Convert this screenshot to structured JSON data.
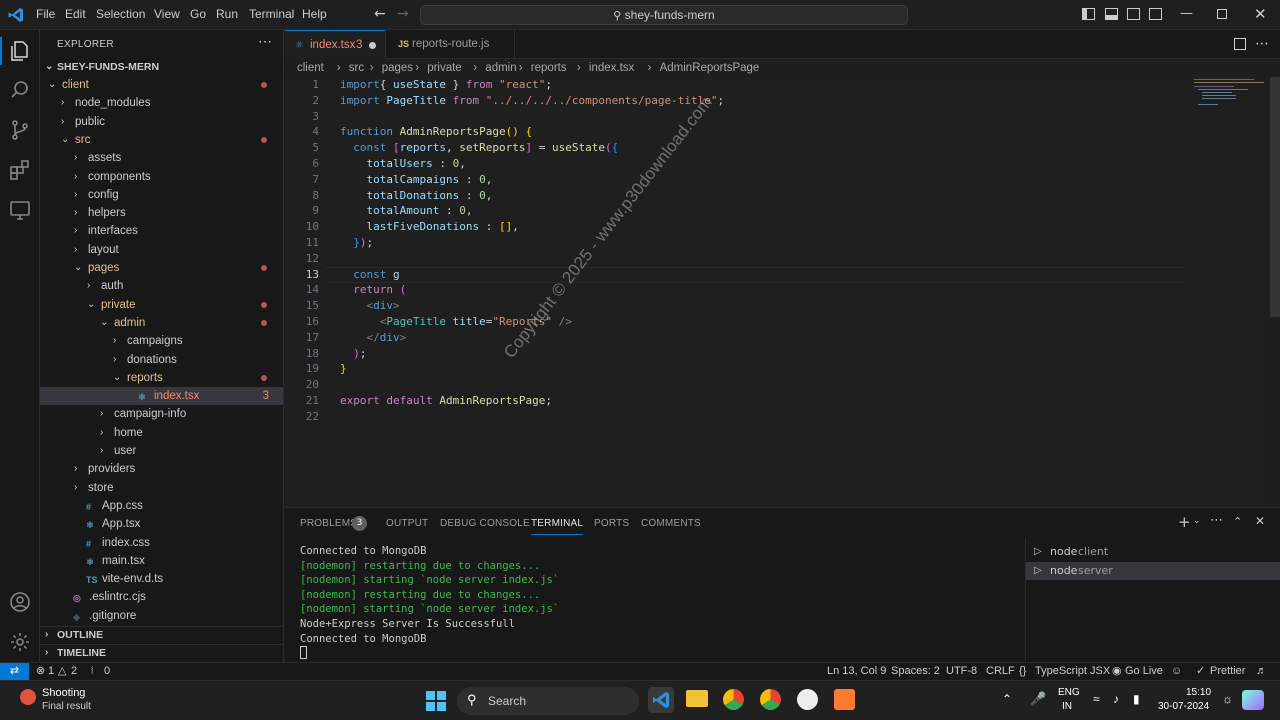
{
  "titlebar": {
    "menus": [
      "File",
      "Edit",
      "Selection",
      "View",
      "Go",
      "Run",
      "Terminal",
      "Help"
    ],
    "search": "shey-funds-mern"
  },
  "explorer": {
    "header": "EXPLORER",
    "root": "SHEY-FUNDS-MERN",
    "items": [
      {
        "label": "client",
        "depth": 0,
        "folder": true,
        "open": true,
        "mod": true
      },
      {
        "label": "node_modules",
        "depth": 1,
        "folder": true
      },
      {
        "label": "public",
        "depth": 1,
        "folder": true
      },
      {
        "label": "src",
        "depth": 1,
        "folder": true,
        "open": true,
        "mod": true
      },
      {
        "label": "assets",
        "depth": 2,
        "folder": true
      },
      {
        "label": "components",
        "depth": 2,
        "folder": true
      },
      {
        "label": "config",
        "depth": 2,
        "folder": true
      },
      {
        "label": "helpers",
        "depth": 2,
        "folder": true
      },
      {
        "label": "interfaces",
        "depth": 2,
        "folder": true
      },
      {
        "label": "layout",
        "depth": 2,
        "folder": true
      },
      {
        "label": "pages",
        "depth": 2,
        "folder": true,
        "open": true,
        "mod": true
      },
      {
        "label": "auth",
        "depth": 3,
        "folder": true
      },
      {
        "label": "private",
        "depth": 3,
        "folder": true,
        "open": true,
        "mod": true
      },
      {
        "label": "admin",
        "depth": 4,
        "folder": true,
        "open": true,
        "mod": true
      },
      {
        "label": "campaigns",
        "depth": 5,
        "folder": true
      },
      {
        "label": "donations",
        "depth": 5,
        "folder": true
      },
      {
        "label": "reports",
        "depth": 5,
        "folder": true,
        "open": true,
        "mod": true
      },
      {
        "label": "index.tsx",
        "depth": 6,
        "file": "tsx",
        "selected": true,
        "badge": "3"
      },
      {
        "label": "campaign-info",
        "depth": 4,
        "folder": true
      },
      {
        "label": "home",
        "depth": 4,
        "folder": true
      },
      {
        "label": "user",
        "depth": 4,
        "folder": true
      },
      {
        "label": "providers",
        "depth": 2,
        "folder": true
      },
      {
        "label": "store",
        "depth": 2,
        "folder": true
      },
      {
        "label": "App.css",
        "depth": 2,
        "file": "css"
      },
      {
        "label": "App.tsx",
        "depth": 2,
        "file": "react"
      },
      {
        "label": "index.css",
        "depth": 2,
        "file": "css"
      },
      {
        "label": "main.tsx",
        "depth": 2,
        "file": "react"
      },
      {
        "label": "vite-env.d.ts",
        "depth": 2,
        "file": "ts"
      },
      {
        "label": ".eslintrc.cjs",
        "depth": 1,
        "file": "eslint"
      },
      {
        "label": ".gitignore",
        "depth": 1,
        "file": "git"
      }
    ],
    "outline": "OUTLINE",
    "timeline": "TIMELINE"
  },
  "tabs": [
    {
      "label": "index.tsx",
      "suffix": "3",
      "active": true
    },
    {
      "label": "reports-route.js",
      "active": false
    }
  ],
  "breadcrumbs": [
    "client",
    "src",
    "pages",
    "private",
    "admin",
    "reports",
    "index.tsx",
    "AdminReportsPage"
  ],
  "editor": {
    "line_numbers": [
      "1",
      "2",
      "3",
      "4",
      "5",
      "6",
      "7",
      "8",
      "9",
      "10",
      "11",
      "12",
      "13",
      "14",
      "15",
      "16",
      "17",
      "18",
      "19",
      "20",
      "21",
      "22"
    ],
    "current_line": "13",
    "lines": [
      [
        [
          "k",
          "import"
        ],
        [
          "",
          "{ "
        ],
        [
          "v",
          "useState"
        ],
        [
          "",
          " } "
        ],
        [
          "kc",
          "from"
        ],
        [
          "",
          " "
        ],
        [
          "s",
          "\"react\""
        ],
        [
          "",
          ";"
        ]
      ],
      [
        [
          "k",
          "import"
        ],
        [
          "",
          " "
        ],
        [
          "v",
          "PageTitle"
        ],
        [
          "",
          " "
        ],
        [
          "kc",
          "from"
        ],
        [
          "",
          " "
        ],
        [
          "s",
          "\"../../../../components/page-title\""
        ],
        [
          "",
          ";"
        ]
      ],
      [],
      [
        [
          "k",
          "function"
        ],
        [
          "",
          " "
        ],
        [
          "f",
          "AdminReportsPage"
        ],
        [
          "p",
          "()"
        ],
        [
          "",
          " "
        ],
        [
          "p",
          "{"
        ]
      ],
      [
        [
          "",
          "  "
        ],
        [
          "k",
          "const"
        ],
        [
          "",
          " "
        ],
        [
          "p2",
          "["
        ],
        [
          "v",
          "reports"
        ],
        [
          "",
          ", "
        ],
        [
          "f",
          "setReports"
        ],
        [
          "p2",
          "]"
        ],
        [
          "",
          " = "
        ],
        [
          "f",
          "useState"
        ],
        [
          "p2",
          "("
        ],
        [
          "p3",
          "{"
        ]
      ],
      [
        [
          "",
          "    "
        ],
        [
          "v",
          "totalUsers"
        ],
        [
          "",
          " : "
        ],
        [
          "n",
          "0"
        ],
        [
          "",
          ","
        ]
      ],
      [
        [
          "",
          "    "
        ],
        [
          "v",
          "totalCampaigns"
        ],
        [
          "",
          " : "
        ],
        [
          "n",
          "0"
        ],
        [
          "",
          ","
        ]
      ],
      [
        [
          "",
          "    "
        ],
        [
          "v",
          "totalDonations"
        ],
        [
          "",
          " : "
        ],
        [
          "n",
          "0"
        ],
        [
          "",
          ","
        ]
      ],
      [
        [
          "",
          "    "
        ],
        [
          "v",
          "totalAmount"
        ],
        [
          "",
          " : "
        ],
        [
          "n",
          "0"
        ],
        [
          "",
          ","
        ]
      ],
      [
        [
          "",
          "    "
        ],
        [
          "v",
          "lastFiveDonations"
        ],
        [
          "",
          " : "
        ],
        [
          "p",
          "[]"
        ],
        [
          "",
          ","
        ]
      ],
      [
        [
          "",
          "  "
        ],
        [
          "p3",
          "}"
        ],
        [
          "p2",
          ")"
        ],
        [
          "",
          ";"
        ]
      ],
      [],
      [
        [
          "",
          "  "
        ],
        [
          "k",
          "const"
        ],
        [
          "",
          " "
        ],
        [
          "v",
          "g"
        ]
      ],
      [
        [
          "",
          "  "
        ],
        [
          "kc",
          "return"
        ],
        [
          "",
          " "
        ],
        [
          "p2",
          "("
        ]
      ],
      [
        [
          "",
          "    "
        ],
        [
          "tg",
          "<"
        ],
        [
          "jt",
          "div"
        ],
        [
          "tg",
          ">"
        ]
      ],
      [
        [
          "",
          "      "
        ],
        [
          "tg",
          "<"
        ],
        [
          "t",
          "PageTitle"
        ],
        [
          "",
          " "
        ],
        [
          "v",
          "title"
        ],
        [
          "",
          "="
        ],
        [
          "s",
          "\"Reports\""
        ],
        [
          "",
          " "
        ],
        [
          "tg",
          "/>"
        ]
      ],
      [
        [
          "",
          "    "
        ],
        [
          "tg",
          "</"
        ],
        [
          "jt",
          "div"
        ],
        [
          "tg",
          ">"
        ]
      ],
      [
        [
          "",
          "  "
        ],
        [
          "p2",
          ")"
        ],
        [
          "",
          ";"
        ]
      ],
      [
        [
          "p",
          "}"
        ]
      ],
      [],
      [
        [
          "kc",
          "export"
        ],
        [
          "",
          " "
        ],
        [
          "kc",
          "default"
        ],
        [
          "",
          " "
        ],
        [
          "f",
          "AdminReportsPage"
        ],
        [
          "",
          ";"
        ]
      ],
      []
    ]
  },
  "panel": {
    "tabs": [
      "PROBLEMS",
      "OUTPUT",
      "DEBUG CONSOLE",
      "TERMINAL",
      "PORTS",
      "COMMENTS"
    ],
    "problems_count": "3",
    "active_tab": "TERMINAL",
    "terminal_lines": [
      {
        "text": "Connected to MongoDB",
        "green": false
      },
      {
        "text": "[nodemon] restarting due to changes...",
        "green": true
      },
      {
        "text": "[nodemon] starting `node server index.js`",
        "green": true
      },
      {
        "text": "[nodemon] restarting due to changes...",
        "green": true
      },
      {
        "text": "[nodemon] starting `node server index.js`",
        "green": true
      },
      {
        "text": "Node+Express Server Is Successfull",
        "green": false
      },
      {
        "text": "Connected to MongoDB",
        "green": false
      }
    ],
    "terminals": [
      {
        "name": "node",
        "label": "client"
      },
      {
        "name": "node",
        "label": "server",
        "active": true
      }
    ]
  },
  "statusbar": {
    "errors": "1",
    "warnings": "2",
    "ports": "0",
    "position": "Ln 13, Col 9",
    "spaces": "Spaces: 2",
    "encoding": "UTF-8",
    "eol": "CRLF",
    "language": "TypeScript JSX",
    "golive": "Go Live",
    "prettier": "Prettier"
  },
  "taskbar": {
    "notify_title": "Shooting",
    "notify_sub": "Final result",
    "search": "Search",
    "lang1": "ENG",
    "lang2": "IN",
    "time": "15:10",
    "date": "30-07-2024"
  },
  "watermark": "Copyright © 2025 - www.p30download.com",
  "colors": {
    "accent": "#0078d4",
    "modified": "#e2c08d",
    "error": "#f48771",
    "term_green": "#3fb950"
  }
}
